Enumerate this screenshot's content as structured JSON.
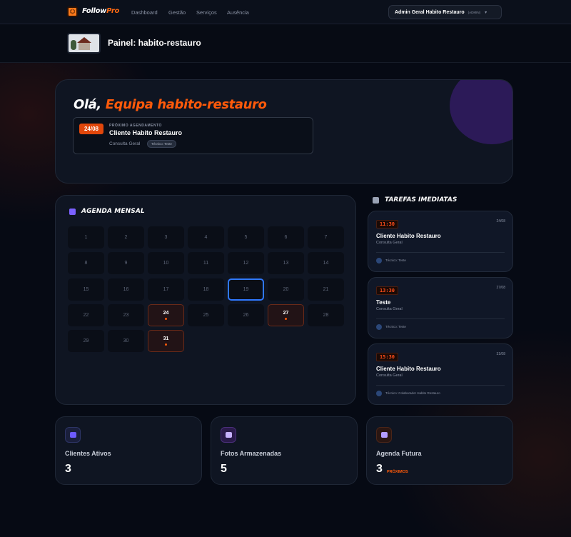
{
  "nav": {
    "logo_main": "Follow",
    "logo_accent": "Pro",
    "links": [
      "Dashboard",
      "Gestão",
      "Serviços",
      "Ausência"
    ],
    "user_name": "Admin Geral Habito Restauro",
    "user_role": "(ADMIN)"
  },
  "subheader": {
    "title": "Painel: habito-restauro"
  },
  "hero": {
    "greeting": "Olá,",
    "team": "Equipa habito-restauro",
    "next": {
      "date": "24/08",
      "label": "PRÓXIMO AGENDAMENTO",
      "client": "Cliente Habito Restauro",
      "service": "Consulta Geral",
      "tech": "Técnico: Teste"
    }
  },
  "calendar": {
    "title": "AGENDA MENSAL",
    "days": [
      "1",
      "2",
      "3",
      "4",
      "5",
      "6",
      "7",
      "8",
      "9",
      "10",
      "11",
      "12",
      "13",
      "14",
      "15",
      "16",
      "17",
      "18",
      "19",
      "20",
      "21",
      "22",
      "23",
      "24",
      "25",
      "26",
      "27",
      "28",
      "29",
      "30",
      "31"
    ],
    "today": "19",
    "booked": [
      "24",
      "27",
      "31"
    ]
  },
  "tasks": {
    "title": "TAREFAS IMEDIATAS",
    "items": [
      {
        "time": "11:30",
        "date": "24/08",
        "client": "Cliente Habito Restauro",
        "service": "Consulta Geral",
        "tech": "Técnico: Teste"
      },
      {
        "time": "13:30",
        "date": "27/08",
        "client": "Teste",
        "service": "Consulta Geral",
        "tech": "Técnico: Teste"
      },
      {
        "time": "15:30",
        "date": "31/08",
        "client": "Cliente Habito Restauro",
        "service": "Consulta Geral",
        "tech": "Técnico: Colaborador Habito Restauro"
      }
    ]
  },
  "stats": [
    {
      "label": "Clientes Ativos",
      "value": "3",
      "extra": "",
      "icon": "users-icon",
      "color": "#6d5bff"
    },
    {
      "label": "Fotos Armazenadas",
      "value": "5",
      "extra": "",
      "icon": "camera-icon",
      "color": "#a36bff"
    },
    {
      "label": "Agenda Futura",
      "value": "3",
      "extra": "PRÓXIMOS",
      "icon": "calendar-icon",
      "color": "#ff5a0a"
    }
  ],
  "colors": {
    "accent": "#ff5a0a",
    "today_ring": "#2f78ff",
    "background": "#060a14"
  }
}
